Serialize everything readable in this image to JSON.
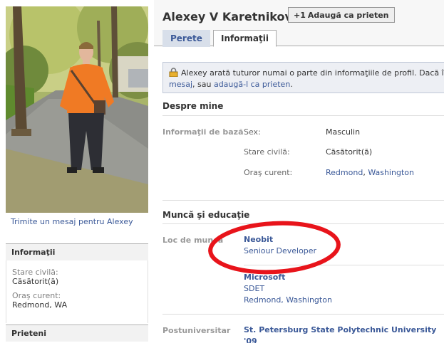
{
  "profile": {
    "name": "Alexey V Karetnikov",
    "add_friend_label": "Adaugă ca prieten",
    "add_friend_icon": "plus-one-icon"
  },
  "tabs": [
    {
      "label": "Perete",
      "active": false
    },
    {
      "label": "Informaţii",
      "active": true
    }
  ],
  "notice": {
    "text_before": "Alexey arată tuturor numai o parte din informaţiile de profil. Dacă îl cunoşti pe",
    "link1": "mesaj",
    "middle": ", sau",
    "link2": "adaugă-l ca prieten",
    "end": "."
  },
  "sidebar": {
    "send_message": "Trimite un mesaj pentru Alexey",
    "info_title": "Informaţii",
    "marital_label": "Stare civilă:",
    "marital_value": "Căsătorit(ă)",
    "city_label": "Oraş curent:",
    "city_value": "Redmond, WA",
    "friends_title": "Prieteni"
  },
  "about": {
    "title": "Despre mine",
    "basic_label": "Informaţii de bază",
    "sex_label": "Sex:",
    "sex_value": "Masculin",
    "marital_label": "Stare civilă:",
    "marital_value": "Căsătorit(ă)",
    "city_label": "Oraş curent:",
    "city_part1": "Redmond",
    "city_part2": "Washington"
  },
  "work": {
    "title": "Muncă şi educaţie",
    "workplace_label": "Loc de muncă",
    "jobs": [
      {
        "company": "Neobit",
        "position": "Seniour Developer",
        "location": ""
      },
      {
        "company": "Microsoft",
        "position": "SDET",
        "location": "Redmond, Washington"
      }
    ],
    "postgrad_label": "Postuniversitar",
    "postgrad_value": "St. Petersburg State Polytechnic University '09"
  },
  "colors": {
    "link": "#3b5998",
    "annotation_circle": "#e8141b",
    "tab_inactive_bg": "#d8dfea",
    "notice_bg": "#edeff4"
  }
}
